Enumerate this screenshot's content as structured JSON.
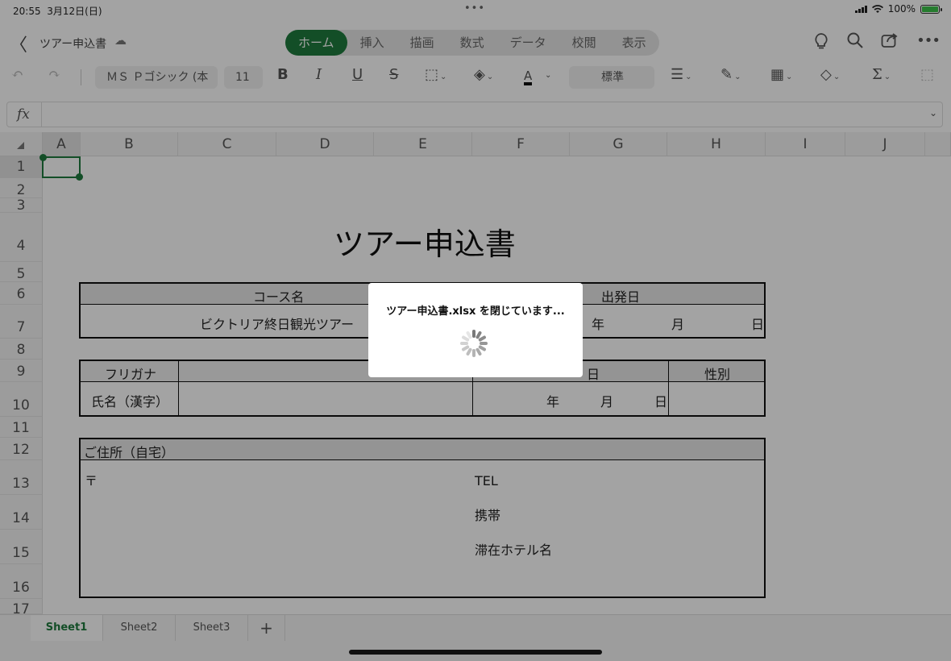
{
  "status": {
    "time": "20:55",
    "date": "3月12日(日)",
    "battery": "100%",
    "wifi_icon": "wifi-icon"
  },
  "title": {
    "doc_name": "ツアー申込書"
  },
  "tabs": [
    {
      "label": "ホーム",
      "active": true
    },
    {
      "label": "挿入"
    },
    {
      "label": "描画"
    },
    {
      "label": "数式"
    },
    {
      "label": "データ"
    },
    {
      "label": "校閲"
    },
    {
      "label": "表示"
    }
  ],
  "toolbar": {
    "font_name": "ＭＳ Ｐゴシック (本",
    "font_size": "11",
    "number_format": "標準",
    "bold": "B",
    "italic": "I",
    "underline": "U",
    "strike": "S",
    "font_color_glyph": "A"
  },
  "formula": {
    "fx": "fx",
    "value": ""
  },
  "columns": [
    "A",
    "B",
    "C",
    "D",
    "E",
    "F",
    "G",
    "H",
    "I",
    "J"
  ],
  "rows": [
    "1",
    "2",
    "3",
    "4",
    "5",
    "6",
    "7",
    "8",
    "9",
    "10",
    "11",
    "12",
    "13",
    "14",
    "15",
    "16",
    "17"
  ],
  "form": {
    "title": "ツアー申込書",
    "course_label": "コース名",
    "course_value": "ビクトリア終日観光ツアー",
    "depart_label": "出発日",
    "year": "年",
    "month": "月",
    "day": "日",
    "furigana": "フリガナ",
    "name_kanji": "氏名（漢字）",
    "birth_label_partial": "日",
    "gender": "性別",
    "address_label": "ご住所（自宅）",
    "postal": "〒",
    "tel": "TEL",
    "mobile": "携帯",
    "hotel": "滞在ホテル名"
  },
  "dialog": {
    "message": "ツアー申込書.xlsx を閉じています..."
  },
  "sheets": [
    {
      "label": "Sheet1",
      "active": true
    },
    {
      "label": "Sheet2"
    },
    {
      "label": "Sheet3"
    }
  ],
  "sheet_add": "+",
  "colors": {
    "accent": "#1f7a3d",
    "overlay": "rgba(0,0,0,0.36)"
  }
}
